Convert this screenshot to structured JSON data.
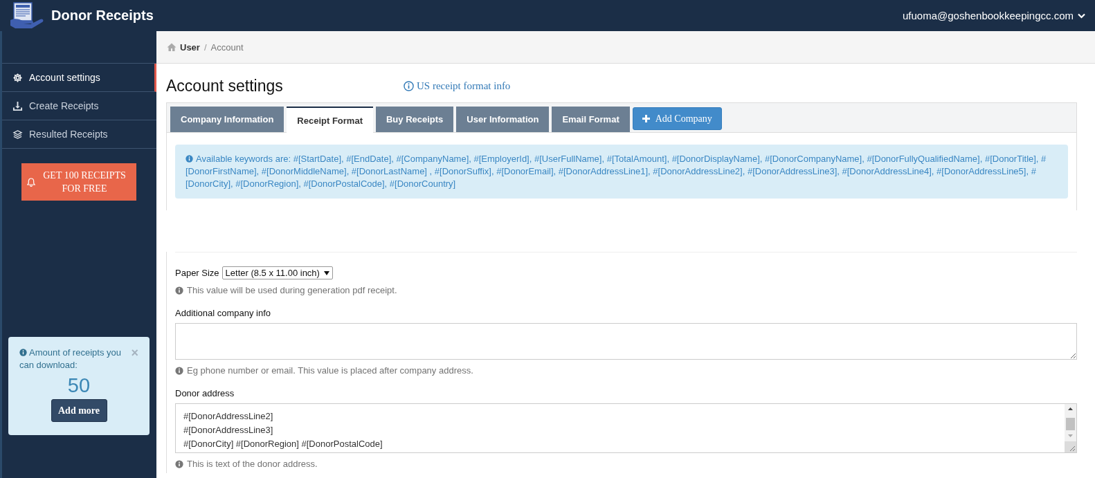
{
  "header": {
    "title": "Donor Receipts",
    "user_email": "ufuoma@goshenbookkeepingcc.com"
  },
  "sidebar": {
    "items": [
      {
        "label": "Account settings",
        "kind": "gear",
        "selected": true
      },
      {
        "label": "Create Receipts",
        "kind": "download",
        "selected": false
      },
      {
        "label": "Resulted Receipts",
        "kind": "layers",
        "selected": false
      }
    ],
    "promo_button": "GET 100 RECEIPTS FOR FREE",
    "info_box": {
      "text": "Amount of receipts you can download:",
      "close": "×",
      "count": "50",
      "button": "Add more"
    }
  },
  "breadcrumb": [
    {
      "label": "User"
    },
    {
      "separator": "/",
      "label": "Account"
    }
  ],
  "page_title": "Account settings",
  "info_link": "US receipt format info",
  "tabs": [
    {
      "label": "Company Information",
      "selected": false
    },
    {
      "label": "Receipt Format",
      "selected": true
    },
    {
      "label": "Buy Receipts",
      "selected": false
    },
    {
      "label": "User Information",
      "selected": false
    },
    {
      "label": "Email Format",
      "selected": false
    }
  ],
  "add_company_button": "Add Company",
  "keywords_alert": "Available keywords are: #[StartDate], #[EndDate], #[CompanyName], #[EmployerId], #[UserFullName], #[TotalAmount], #[DonorDisplayName], #[DonorCompanyName], #[DonorFullyQualifiedName], #[DonorTitle], #[DonorFirstName], #[DonorMiddleName], #[DonorLastName] , #[DonorSuffix], #[DonorEmail], #[DonorAddressLine1], #[DonorAddressLine2], #[DonorAddressLine3], #[DonorAddressLine4], #[DonorAddressLine5], #[DonorCity], #[DonorRegion], #[DonorPostalCode], #[DonorCountry]",
  "form": {
    "paper_size": {
      "label": "Paper Size",
      "value": "Letter (8.5 x 11.00 inch)",
      "hint": "This value will be used during generation pdf receipt."
    },
    "additional_info": {
      "label": "Additional company info",
      "hint": "Eg phone number or email. This value is placed after company address."
    },
    "donor_address": {
      "label": "Donor address",
      "lines": [
        "#[DonorAddressLine2]",
        "#[DonorAddressLine3]",
        "#[DonorCity] #[DonorRegion] #[DonorPostalCode]"
      ],
      "hint": "This is text of the donor address."
    }
  }
}
